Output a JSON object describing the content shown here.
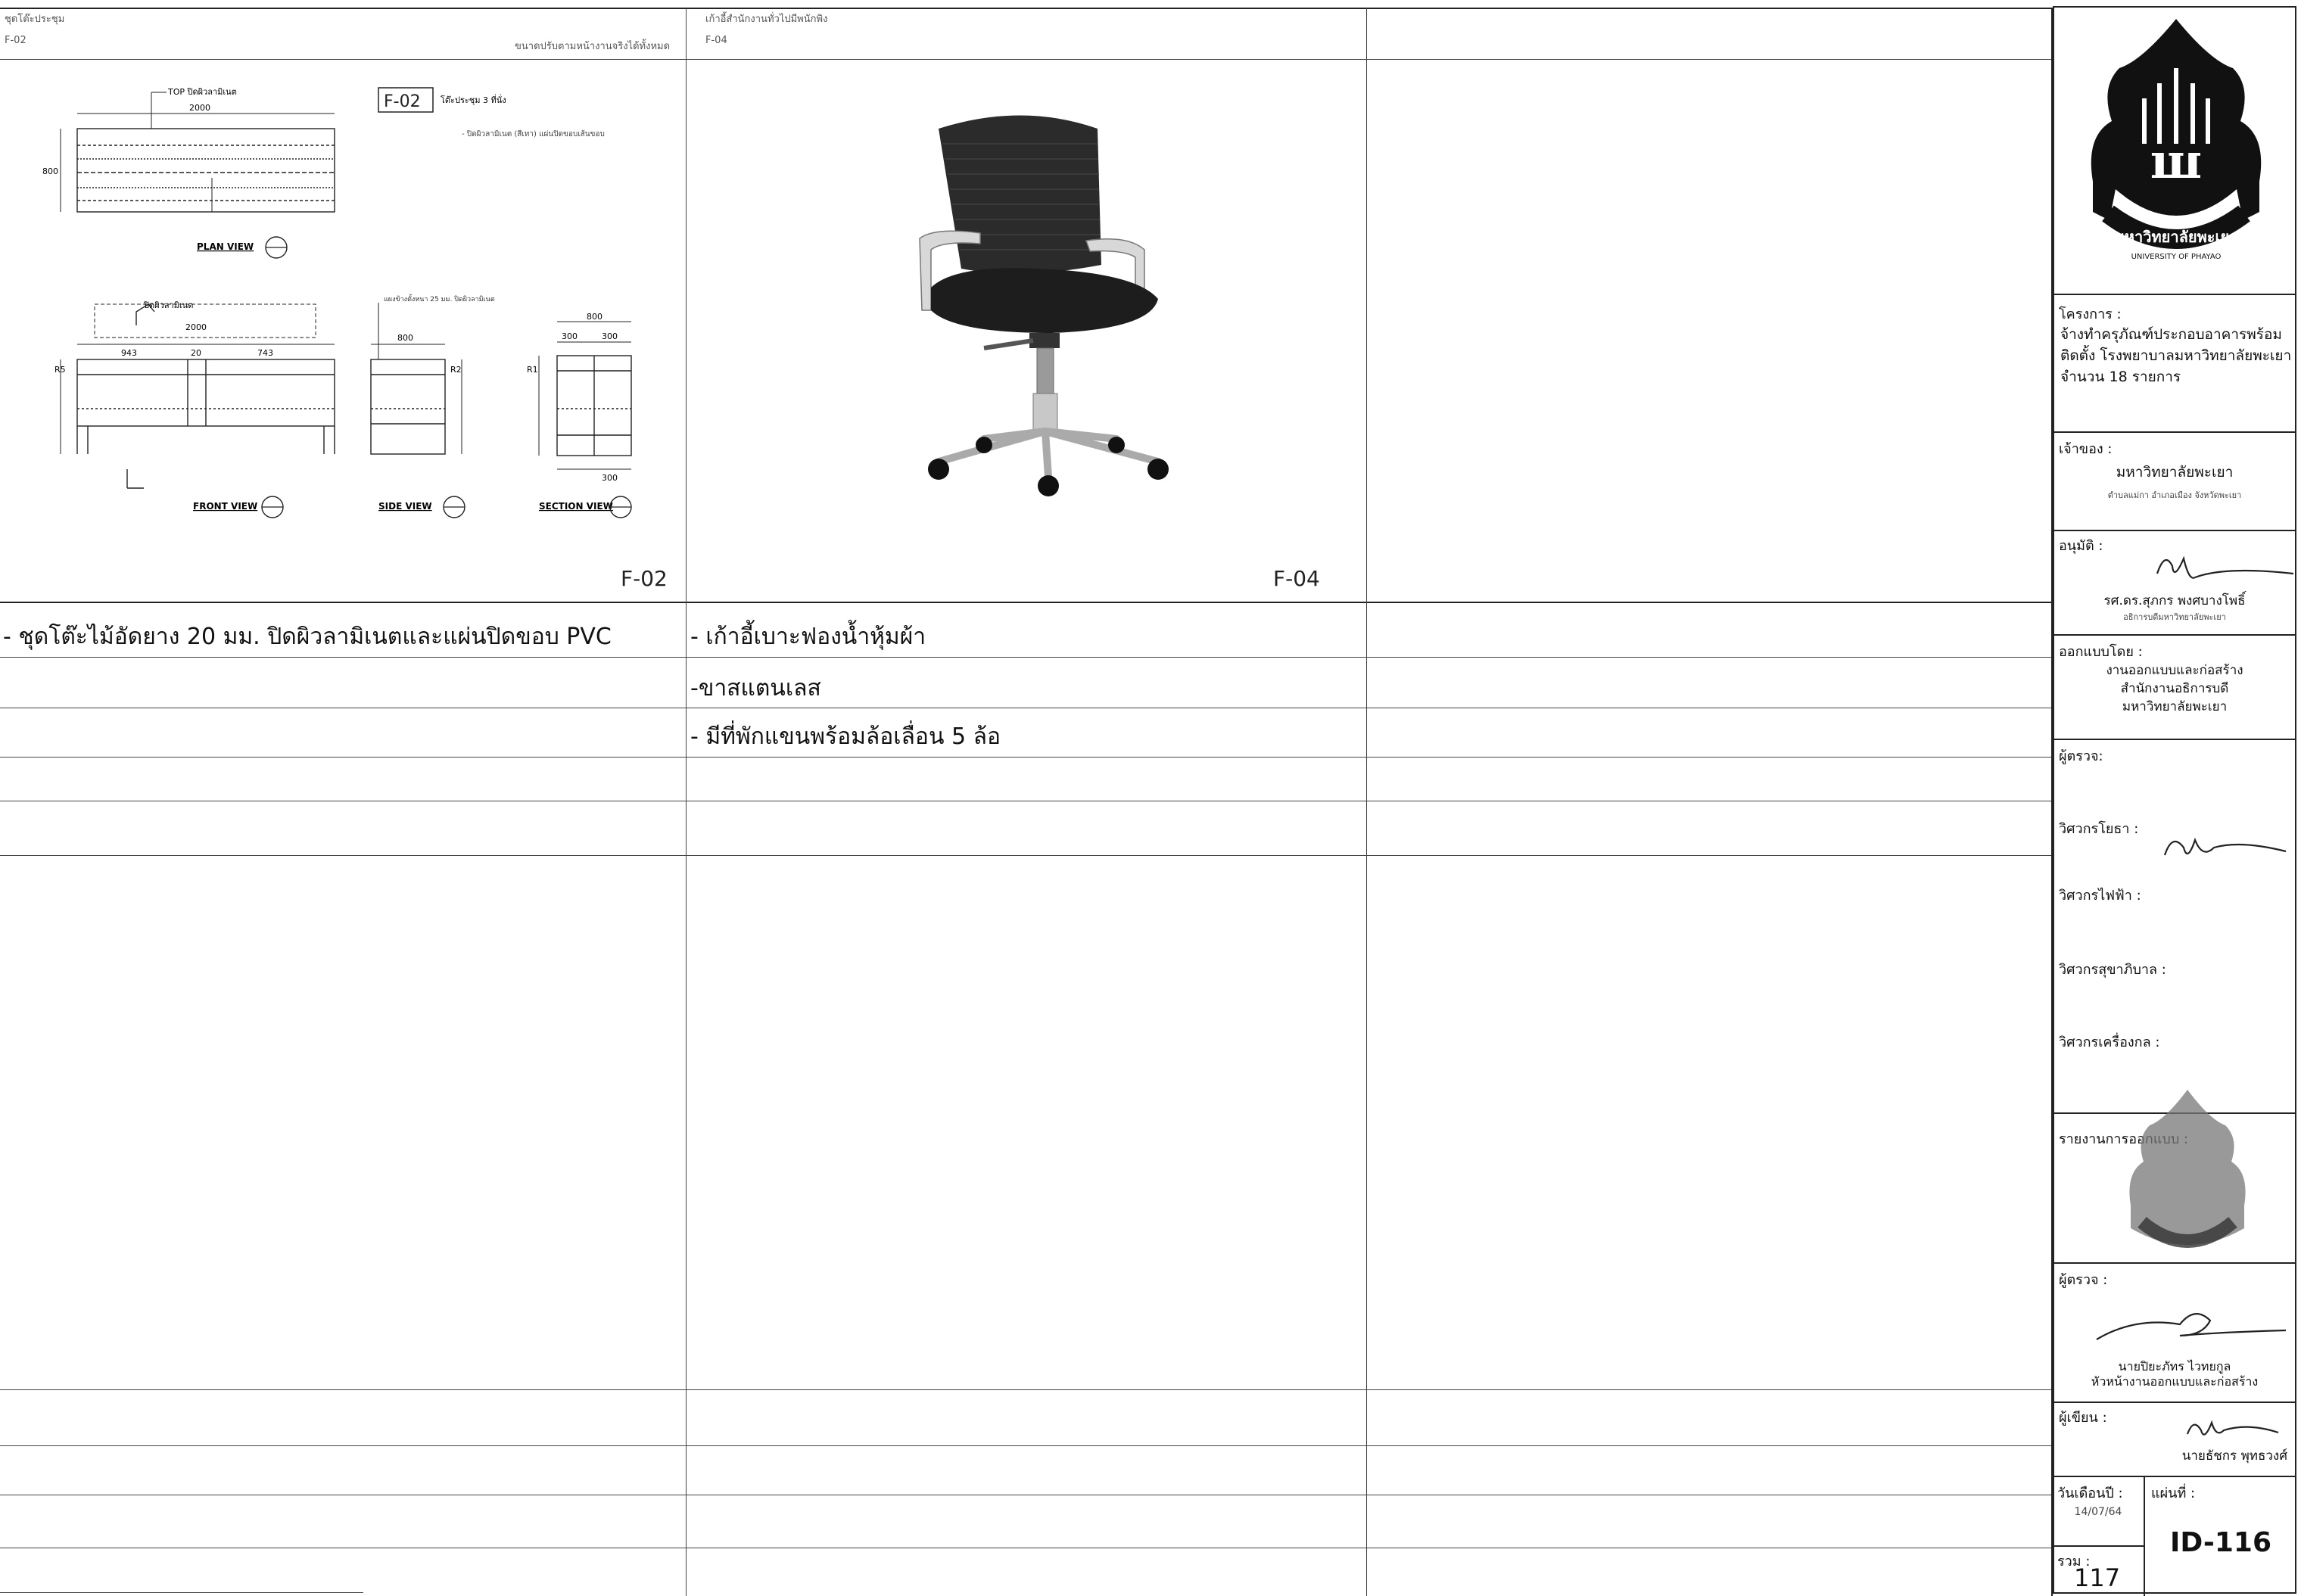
{
  "columns": [
    {
      "header_top": "ชุดโต๊ะประชุม",
      "header_code": "F-02",
      "header_right": "ขนาดปรับตามหน้างานจริงได้ทั้งหมด",
      "code": "F-02",
      "drawing": {
        "tag": "F-02",
        "title": "โต๊ะประชุม 3 ที่นั่ง",
        "note": "- ปิดผิวลามิเนต (สีเทา) แผ่นปิดขอบเส้นขอบ",
        "top_note": "TOP ปิดผิวลามิเนต",
        "front_note": "ปิดผิวลามิเนต",
        "side_note": "แผงข้างตั้งหนา 25 มม. ปิดผิวลามิเนต",
        "dims": {
          "plan_width": "2000",
          "plan_depth": "800",
          "front_width": "2000",
          "front_left": "943",
          "front_mid": "20",
          "front_right": "743",
          "front_r": "R5",
          "side_width": "800",
          "side_r": "R2",
          "section_a": "800",
          "section_b": "300",
          "section_c": "300",
          "section_d": "300",
          "section_r": "R1"
        },
        "views": [
          "PLAN VIEW",
          "FRONT VIEW",
          "SIDE VIEW",
          "SECTION VIEW"
        ]
      },
      "rows": [
        "- ชุดโต๊ะไม้อัดยาง 20 มม. ปิดผิวลามิเนตและแผ่นปิดขอบ PVC",
        "",
        "",
        "",
        ""
      ]
    },
    {
      "header_top": "เก้าอี้สำนักงานทั่วไปมีพนักพิง",
      "header_code": "F-04",
      "code": "F-04",
      "rows": [
        "- เก้าอี้เบาะฟองน้ำหุ้มผ้า",
        "-ขาสแตนเลส",
        "- มีที่พักแขนพร้อมล้อเลื่อน 5 ล้อ",
        "",
        ""
      ]
    },
    {
      "rows": [
        "",
        "",
        "",
        "",
        ""
      ]
    }
  ],
  "title_block": {
    "logo": {
      "name": "university-crest",
      "text_ring": "มหาวิทยาลัยพะเยา",
      "text_en": "UNIVERSITY OF PHAYAO"
    },
    "project_label": "โครงการ :",
    "project_text": "จ้างทำครุภัณฑ์ประกอบอาคารพร้อมติดตั้ง โรงพยาบาลมหาวิทยาลัยพะเยา จำนวน 18 รายการ",
    "owner_label": "เจ้าของ :",
    "owner_name": "มหาวิทยาลัยพะเยา",
    "owner_address": "ตำบลแม่กา อำเภอเมือง จังหวัดพะเยา",
    "approve_label": "อนุมัติ :",
    "approve_name": "รศ.ดร.สุภกร พงศบางโพธิ์",
    "approve_title": "อธิการบดีมหาวิทยาลัยพะเยา",
    "design_label": "ออกแบบโดย :",
    "design_text": [
      "งานออกแบบและก่อสร้าง",
      "สำนักงานอธิการบดี",
      "มหาวิทยาลัยพะเยา"
    ],
    "check_label": "ผู้ตรวจ:",
    "eng_civil": "วิศวกรโยธา :",
    "eng_electric": "วิศวกรไฟฟ้า :",
    "eng_sanitary": "วิศวกรสุขาภิบาล :",
    "eng_mechanical": "วิศวกรเครื่องกล :",
    "architect_label": "รายงานการออกแบบ :",
    "checker_label": "ผู้ตรวจ :",
    "checker_name": "นายปิยะภัทร ไวทยกูล",
    "checker_title": "หัวหน้างานออกแบบและก่อสร้าง",
    "writer_label": "ผู้เขียน :",
    "writer_name": "นายธัชกร พุทธวงศ์",
    "date_label": "วันเดือนปี :",
    "date_value": "14/07/64",
    "sheet_label": "แผ่นที่ :",
    "sheet_value": "ID-116",
    "total_label": "รวม :",
    "total_value": "117"
  }
}
